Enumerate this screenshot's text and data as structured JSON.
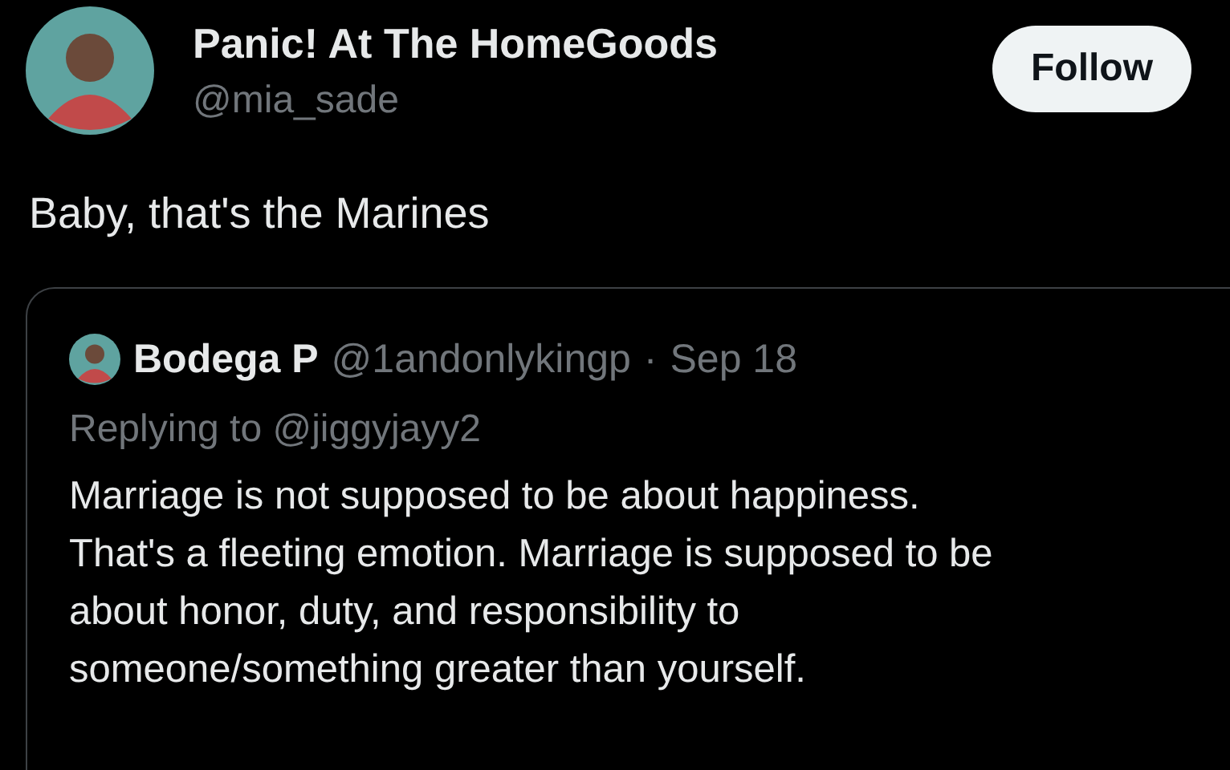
{
  "author": {
    "name": "Panic! At The HomeGoods",
    "handle": "@mia_sade"
  },
  "follow_button": {
    "label": "Follow"
  },
  "tweet_text": "Baby, that's the Marines",
  "quoted_tweet": {
    "name": "Bodega P",
    "handle": "@1andonlykingp",
    "separator": "·",
    "date": "Sep 18",
    "replying_to": "Replying to @jiggyjayy2",
    "text_lines": [
      "Marriage is not supposed to be about happiness.",
      "That's a fleeting emotion. Marriage is supposed to be",
      "about honor, duty, and responsibility to",
      "someone/something greater than yourself."
    ]
  }
}
